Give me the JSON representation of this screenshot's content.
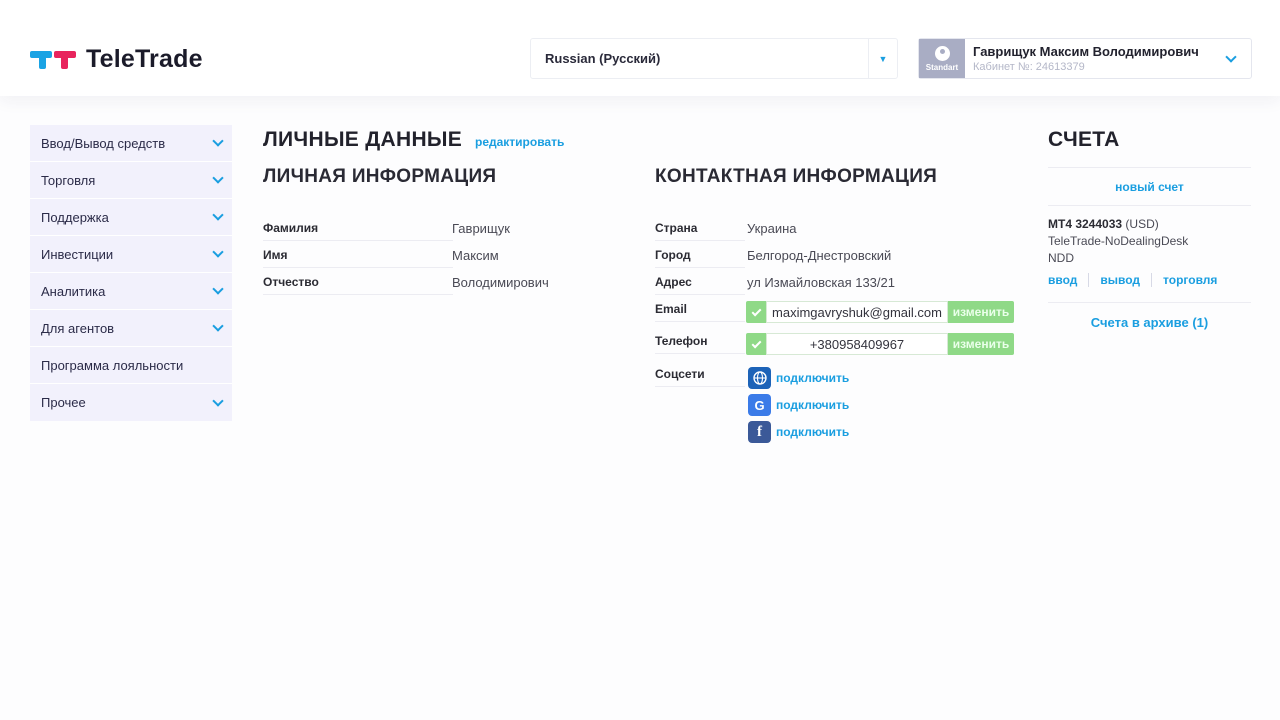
{
  "brand": {
    "name": "TeleTrade"
  },
  "language": {
    "selected": "Russian (Русский)"
  },
  "user": {
    "name": "Гаврищук Максим Володимирович",
    "cabinet": "Кабинет №: 24613379",
    "level": "Standart"
  },
  "sidebar": {
    "items": [
      {
        "label": "Ввод/Вывод средств",
        "has_arrow": true
      },
      {
        "label": "Торговля",
        "has_arrow": true
      },
      {
        "label": "Поддержка",
        "has_arrow": true
      },
      {
        "label": "Инвестиции",
        "has_arrow": true
      },
      {
        "label": "Аналитика",
        "has_arrow": true
      },
      {
        "label": "Для агентов",
        "has_arrow": true
      },
      {
        "label": "Программа лояльности",
        "has_arrow": false
      },
      {
        "label": "Прочее",
        "has_arrow": true
      }
    ]
  },
  "personal": {
    "title": "ЛИЧНЫЕ ДАННЫЕ",
    "edit_link": "редактировать",
    "info_title": "ЛИЧНАЯ ИНФОРМАЦИЯ",
    "fields": [
      {
        "label": "Фамилия",
        "value": "Гаврищук"
      },
      {
        "label": "Имя",
        "value": "Максим"
      },
      {
        "label": "Отчество",
        "value": "Володимирович"
      }
    ]
  },
  "contact": {
    "title": "КОНТАКТНАЯ ИНФОРМАЦИЯ",
    "country_label": "Страна",
    "country": "Украина",
    "city_label": "Город",
    "city": "Белгород-Днестровский",
    "address_label": "Адрес",
    "address": "ул Измайловская 133/21",
    "email_label": "Email",
    "email": "maximgavryshuk@gmail.com",
    "phone_label": "Телефон",
    "phone": "+380958409967",
    "change_label": "изменить",
    "social_label": "Соцсети",
    "social": [
      {
        "icon": "globe-icon",
        "label": "подключить",
        "color": "#1d63b8"
      },
      {
        "icon": "google-icon",
        "label": "подключить",
        "color": "#3b7be8"
      },
      {
        "icon": "facebook-icon",
        "label": "подключить",
        "color": "#3b5998"
      }
    ]
  },
  "accounts": {
    "title": "СЧЕТА",
    "new_account": "новый счет",
    "account_id": "MT4 3244033",
    "account_currency": "(USD)",
    "account_server": "TeleTrade-NoDealingDesk",
    "account_type": "NDD",
    "actions": [
      "ввод",
      "вывод",
      "торговля"
    ],
    "archive": "Счета в архиве (1)"
  },
  "colors": {
    "accent": "#1a9ee0",
    "success": "#8fd987",
    "brand_blue": "#1aa3e4",
    "brand_red": "#e8245d"
  }
}
